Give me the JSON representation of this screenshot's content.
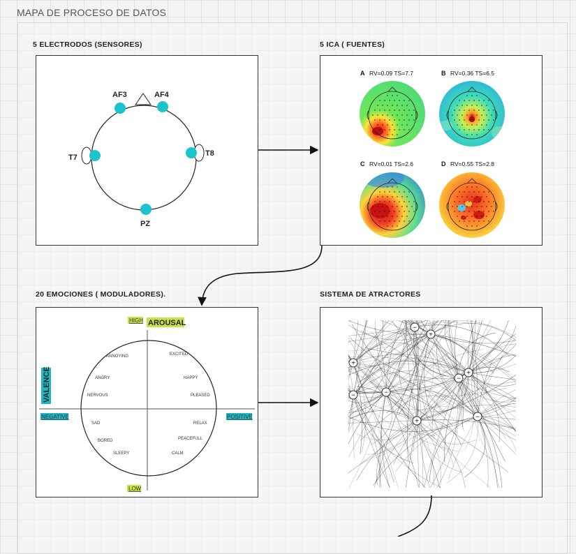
{
  "page": {
    "title": "MAPA DE PROCESO DE DATOS"
  },
  "sections": {
    "electrodes": "5 ELECTRODOS (SENSORES)",
    "ica": "5 ICA ( FUENTES)",
    "emotions": "20 EMOCIONES ( MODULADORES).",
    "attractors": "SISTEMA DE ATRACTORES"
  },
  "electrodes": {
    "color": "#1bc4cc",
    "labels": {
      "af3": "AF3",
      "af4": "AF4",
      "t7": "T7",
      "t8": "T8",
      "pz": "PZ"
    }
  },
  "ica": {
    "components": [
      {
        "letter": "A",
        "stats": "RV=0.09  TS=7.7"
      },
      {
        "letter": "B",
        "stats": "RV=0.36  TS=6.5"
      },
      {
        "letter": "C",
        "stats": "RV=0.01  TS=2.6"
      },
      {
        "letter": "D",
        "stats": "RV=0.55  TS=2.8"
      }
    ]
  },
  "emotions": {
    "axes": {
      "high": "HIGH",
      "arousal": "AROUSAL",
      "low": "LOW",
      "valence": "VALENCE",
      "negative": "NEGATIVE",
      "positive": "POSITIVE"
    },
    "words": {
      "annoying": "ANNOYING",
      "excited": "EXCITED",
      "angry": "ANGRY",
      "happy": "HAPPY",
      "nervous": "NERVOUS",
      "pleased": "PLEASED",
      "sad": "SAD",
      "relax": "RELAX",
      "bored": "BORED",
      "peacefull": "PEACEFULL",
      "sleepy": "SLEEPY",
      "calm": "CALM"
    },
    "colors": {
      "yellow_green": "#c6e34a",
      "cyan": "#1bb8c4"
    }
  },
  "attractors": {
    "symbols": {
      "plus": "+",
      "minus": "−"
    }
  }
}
